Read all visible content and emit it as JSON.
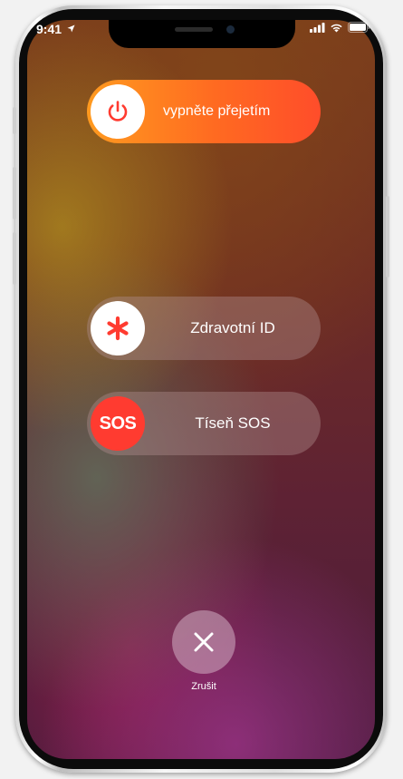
{
  "status_bar": {
    "time": "9:41"
  },
  "power_slider": {
    "label": "vypněte přejetím",
    "icon": "power-icon"
  },
  "medical_slider": {
    "label": "Zdravotní ID",
    "icon": "asterisk-icon"
  },
  "sos_slider": {
    "label": "Tíseň SOS",
    "icon_text": "SOS"
  },
  "cancel": {
    "label": "Zrušit",
    "icon": "close-icon"
  },
  "colors": {
    "power_gradient_start": "#ff9a1f",
    "power_gradient_end": "#ff4d2a",
    "sos_red": "#ff3b30",
    "asterisk_red": "#ff3b30"
  }
}
